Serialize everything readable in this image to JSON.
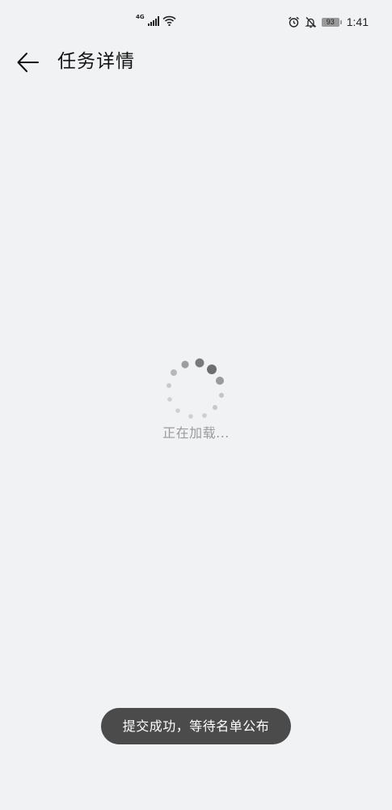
{
  "status_bar": {
    "network_type": "4G",
    "time": "1:41",
    "battery_level": "93",
    "icons": [
      "signal-icon",
      "wifi-icon",
      "alarm-icon",
      "mute-bell-icon",
      "battery-icon"
    ]
  },
  "header": {
    "title": "任务详情",
    "back_icon": "arrow-left-icon"
  },
  "loading": {
    "text": "正在加载..."
  },
  "toast": {
    "message": "提交成功，等待名单公布"
  }
}
